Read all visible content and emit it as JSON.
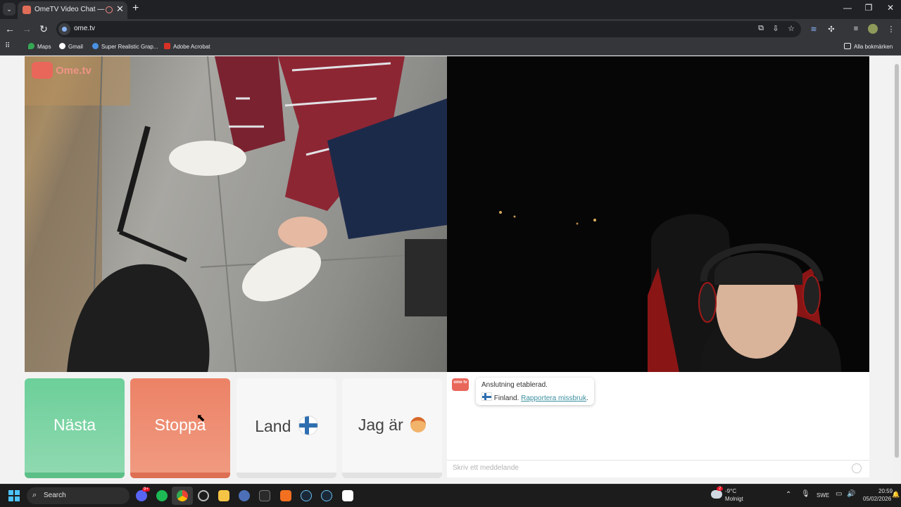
{
  "browser": {
    "tab_title": "OmeTV Video Chat — Ome",
    "tab_close": "✕",
    "new_tab": "+",
    "url": "ome.tv",
    "window_controls": {
      "minimize": "—",
      "restore": "❐",
      "close": "✕"
    },
    "bookmarks": [
      {
        "label": "Maps",
        "icon": "maps-icon",
        "color": "#34a853"
      },
      {
        "label": "Gmail",
        "icon": "google-icon",
        "color": "#ffffff"
      },
      {
        "label": "Super Realistic Grap...",
        "icon": "eye-icon",
        "color": "#4a90e2"
      },
      {
        "label": "Adobe Acrobat",
        "icon": "acrobat-icon",
        "color": "#d93025"
      }
    ],
    "all_bookmarks": "Alla bokmärken"
  },
  "ometv": {
    "logo_text": "Ome.tv",
    "buttons": {
      "next": {
        "label": "Nästa",
        "color": "#7bd1a2"
      },
      "stop": {
        "label": "Stoppa",
        "color": "#ef8a70"
      },
      "country": {
        "label": "Land",
        "flag": "🇫🇮"
      },
      "gender": {
        "label": "Jag är",
        "icon": "🧑"
      }
    }
  },
  "chat": {
    "logo_text": "ome tv",
    "message_line1": "Anslutning etablerad.",
    "flag": "🇫🇮",
    "country_text": "Finland.",
    "report_link": "Rapportera missbruk",
    "period": ".",
    "input_placeholder": "Skriv ett meddelande"
  },
  "taskbar": {
    "search_placeholder": "Search",
    "weather_temp": "-9°C",
    "weather_desc": "Molnigt",
    "weather_badge": "2",
    "language": "SWE",
    "time": "20:59",
    "date": "05/02/2026",
    "discord_badge": "9+"
  }
}
